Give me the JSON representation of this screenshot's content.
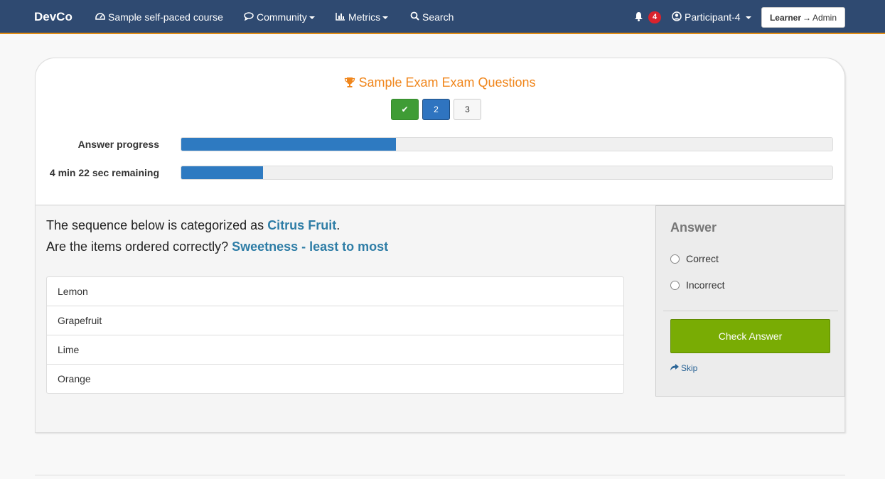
{
  "navbar": {
    "brand": "DevCo",
    "course": {
      "label": "Sample self-paced course",
      "icon": "dashboard-icon"
    },
    "community": {
      "label": "Community",
      "icon": "comments-icon"
    },
    "metrics": {
      "label": "Metrics",
      "icon": "bar-chart-icon"
    },
    "search": {
      "label": "Search",
      "icon": "search-icon"
    },
    "notifications": {
      "count": "4",
      "icon": "bell-icon"
    },
    "user": {
      "label": "Participant-4",
      "icon": "user-circle-icon"
    },
    "role_switch": {
      "from": "Learner",
      "arrow": "→",
      "to": "Admin"
    }
  },
  "exam": {
    "title": "Sample Exam Exam Questions",
    "title_icon": "trophy-icon",
    "questions": [
      {
        "label": "✔",
        "state": "done"
      },
      {
        "label": "2",
        "state": "current"
      },
      {
        "label": "3",
        "state": "pending"
      }
    ],
    "answer_progress": {
      "label": "Answer progress",
      "percent": 33
    },
    "time_remaining": {
      "label": "4 min 22 sec remaining",
      "percent": 12.5
    }
  },
  "question": {
    "line1_prefix": "The sequence below is categorized as ",
    "category": "Citrus Fruit",
    "line1_suffix": ".",
    "line2_prefix": "Are the items ordered correctly? ",
    "criterion": "Sweetness - least to most",
    "items": [
      "Lemon",
      "Grapefruit",
      "Lime",
      "Orange"
    ]
  },
  "answer": {
    "title": "Answer",
    "options": [
      "Correct",
      "Incorrect"
    ],
    "check_label": "Check Answer",
    "skip_label": "Skip",
    "skip_icon": "share-icon"
  },
  "colors": {
    "navbar": "#2f4a71",
    "accent_orange": "#f0861c",
    "progress_blue": "#2e7ac1",
    "check_green": "#79ac04",
    "highlight_blue": "#2e7da6"
  }
}
